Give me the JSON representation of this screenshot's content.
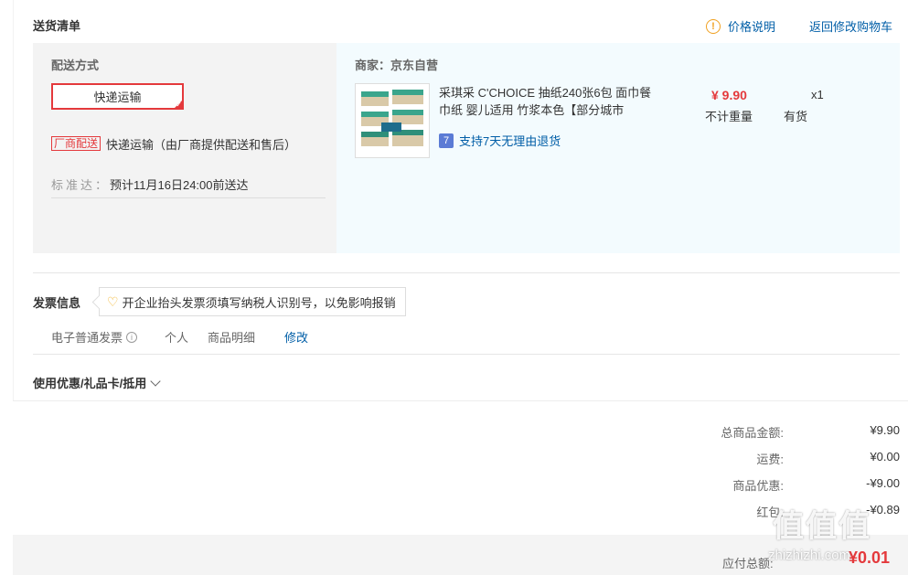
{
  "header": {
    "title": "送货清单",
    "price_note": "价格说明",
    "back_to_cart": "返回修改购物车"
  },
  "shipping": {
    "label": "配送方式",
    "method_button": "快递运输",
    "vendor_tag": "厂商配送",
    "vendor_desc": "快递运输（由厂商提供配送和售后）",
    "standard_key": "标准达：",
    "standard_value": "预计11月16日24:00前送达"
  },
  "merchant": {
    "label": "商家：京东自营",
    "product_name": "采琪采 C'CHOICE 抽纸240张6包 面巾餐巾纸 婴儿适用 竹浆本色【部分城市",
    "support_badge": "7",
    "support_text": "支持7天无理由退货",
    "price": "¥ 9.90",
    "weight": "不计重量",
    "qty": "x1",
    "stock": "有货"
  },
  "invoice": {
    "label": "发票信息",
    "tip": "开企业抬头发票须填写纳税人识别号，以免影响报销",
    "type": "电子普通发票",
    "person": "个人",
    "detail": "商品明细",
    "edit": "修改"
  },
  "coupon": {
    "label": "使用优惠/礼品卡/抵用"
  },
  "summary": {
    "goods_label": "总商品金额:",
    "goods_value": "¥9.90",
    "freight_label": "运费:",
    "freight_value": "¥0.00",
    "discount_label": "商品优惠:",
    "discount_value": "-¥9.00",
    "redpacket_label": "红包:",
    "redpacket_value": "-¥0.89",
    "total_label": "应付总额:",
    "total_value": "¥0.01"
  },
  "watermark": {
    "text": "值值值",
    "url": "zhizhizhi.com"
  },
  "colors": {
    "accent_red": "#e4393c",
    "link_blue": "#005ea7",
    "product_bg": "#f3fbfe"
  }
}
